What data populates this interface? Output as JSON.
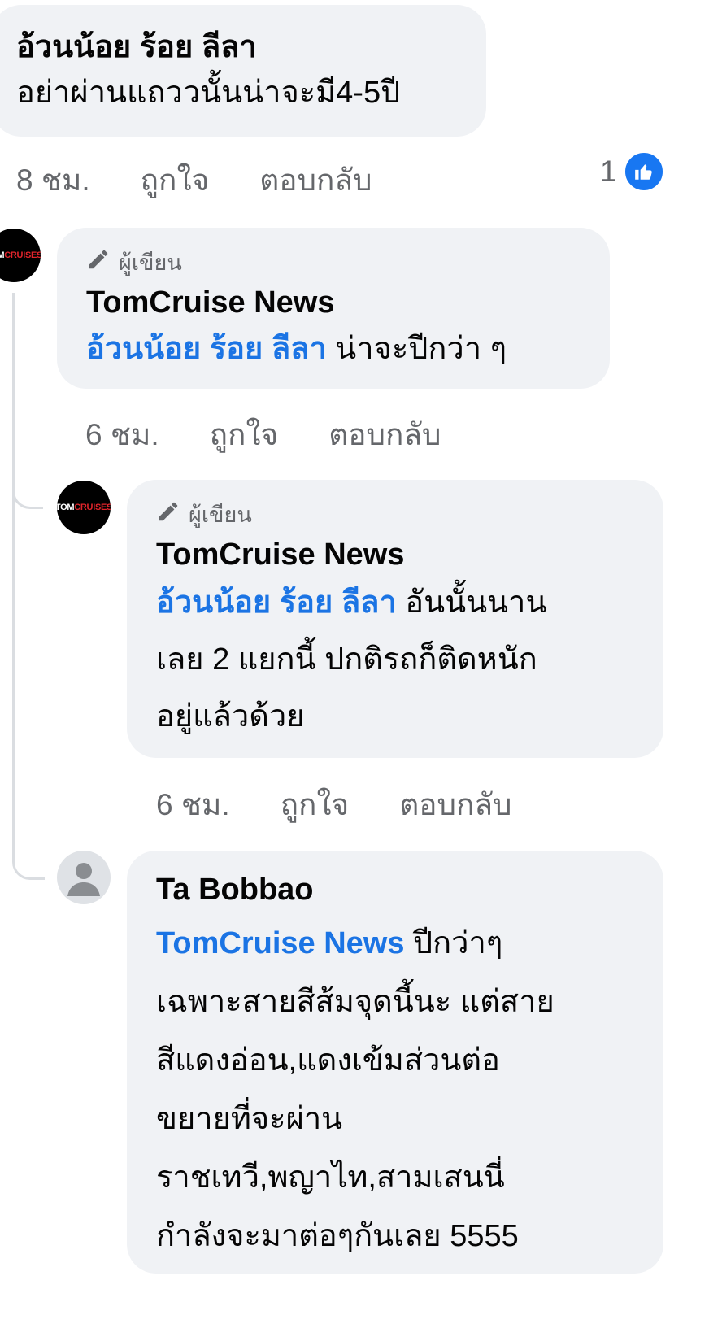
{
  "comment1": {
    "author": "อ้วนน้อย ร้อย ลีลา",
    "text": "อย่าผ่านแถววนั้นน่าจะมี4-5ปี",
    "time": "8 ชม.",
    "like_label": "ถูกใจ",
    "reply_label": "ตอบกลับ",
    "reaction_count": "1",
    "reaction_icon": "like-icon"
  },
  "reply1": {
    "author_badge": "ผู้เขียน",
    "author": "TomCruise News",
    "mention": "อ้วนน้อย ร้อย ลีลา",
    "text": " น่าจะปีกว่า ๆ",
    "time": "6 ชม.",
    "like_label": "ถูกใจ",
    "reply_label": "ตอบกลับ"
  },
  "reply2": {
    "author_badge": "ผู้เขียน",
    "author": "TomCruise News",
    "mention": "อ้วนน้อย ร้อย ลีลา",
    "text_line1": " อันนั้นนาน",
    "text_line2": "เลย 2 แยกนี้ ปกติรถก็ติดหนัก",
    "text_line3": "อยู่แล้วด้วย",
    "time": "6 ชม.",
    "like_label": "ถูกใจ",
    "reply_label": "ตอบกลับ"
  },
  "reply3": {
    "author": "Ta Bobbao",
    "mention": "TomCruise News",
    "lines": [
      " ปีกว่าๆ",
      "เฉพาะสายสีส้มจุดนี้นะ แต่สาย",
      "สีแดงอ่อน,แดงเข้มส่วนต่อ",
      "ขยายที่จะผ่าน",
      "ราชเทวี,พญาไท,สามเสนนี่",
      "กำลังจะมาต่อๆกันเลย 5555"
    ]
  },
  "colors": {
    "mention": "#1b74e4",
    "bubble": "#f0f2f5",
    "meta": "#65676b",
    "like_blue": "#1877f2"
  }
}
